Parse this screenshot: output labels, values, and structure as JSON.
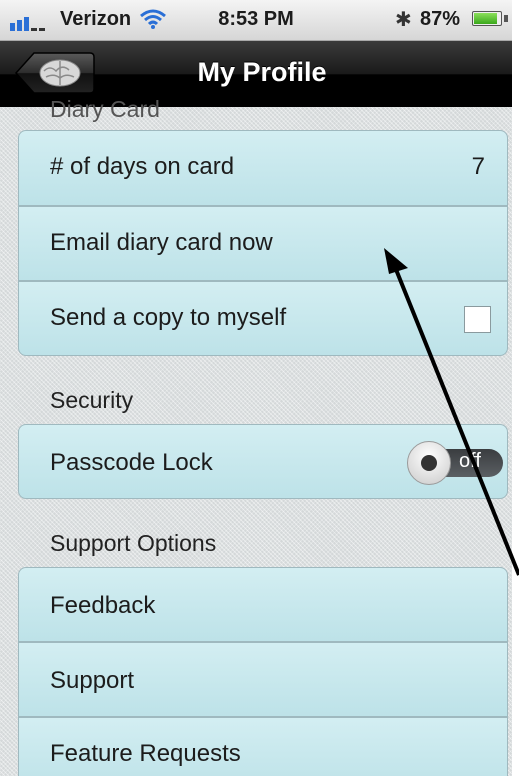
{
  "status_bar": {
    "carrier": "Verizon",
    "time": "8:53 PM",
    "battery_percent": "87%",
    "battery_level": 0.87
  },
  "nav": {
    "title": "My Profile",
    "back_icon": "brain-icon"
  },
  "sections": {
    "diary_card": {
      "header": "Diary Card",
      "days_label": "# of days on card",
      "days_value": "7",
      "email_label": "Email diary card now",
      "copy_label": "Send a copy to myself",
      "copy_checked": false
    },
    "security": {
      "header": "Security",
      "passcode_label": "Passcode Lock",
      "passcode_state": "off"
    },
    "support": {
      "header": "Support Options",
      "items": [
        "Feedback",
        "Support",
        "Feature Requests"
      ]
    }
  },
  "colors": {
    "cell_bg": "#c9e8ed",
    "navbar": "#000000"
  }
}
